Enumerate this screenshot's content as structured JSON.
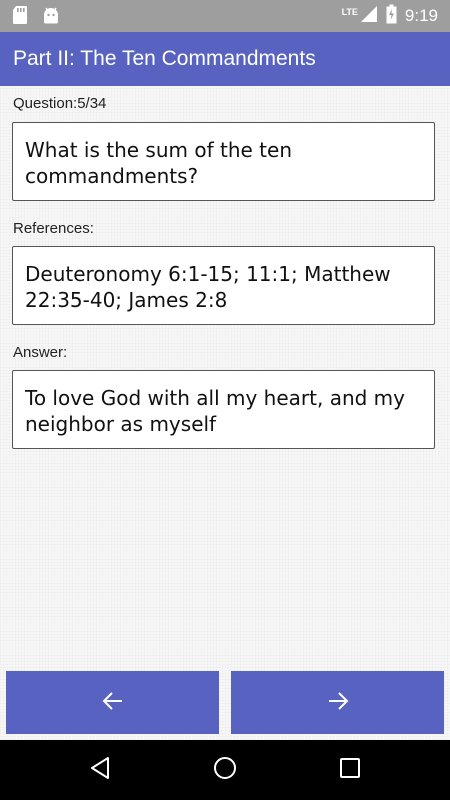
{
  "status_bar": {
    "time": "9:19",
    "network": "LTE",
    "icons": [
      "sd-card-icon",
      "android-icon",
      "lte-signal-icon",
      "battery-icon"
    ]
  },
  "app_bar": {
    "title": "Part II: The Ten Commandments"
  },
  "question": {
    "label": "Question:5/34",
    "text": "What is the sum of the ten commandments?"
  },
  "references": {
    "label": "References:",
    "text": "Deuteronomy 6:1-15; 11:1; Matthew 22:35-40; James 2:8"
  },
  "answer": {
    "label": "Answer:",
    "text": "To love God with all my heart, and my neighbor as myself"
  },
  "navigation": {
    "prev_icon": "arrow-left-icon",
    "next_icon": "arrow-right-icon"
  },
  "system_nav": {
    "icons": [
      "back-icon",
      "home-icon",
      "recents-icon"
    ]
  },
  "colors": {
    "primary": "#5862c0",
    "status_bar": "#9e9e9e",
    "background": "#f7f7f7",
    "card_border": "#555555"
  }
}
